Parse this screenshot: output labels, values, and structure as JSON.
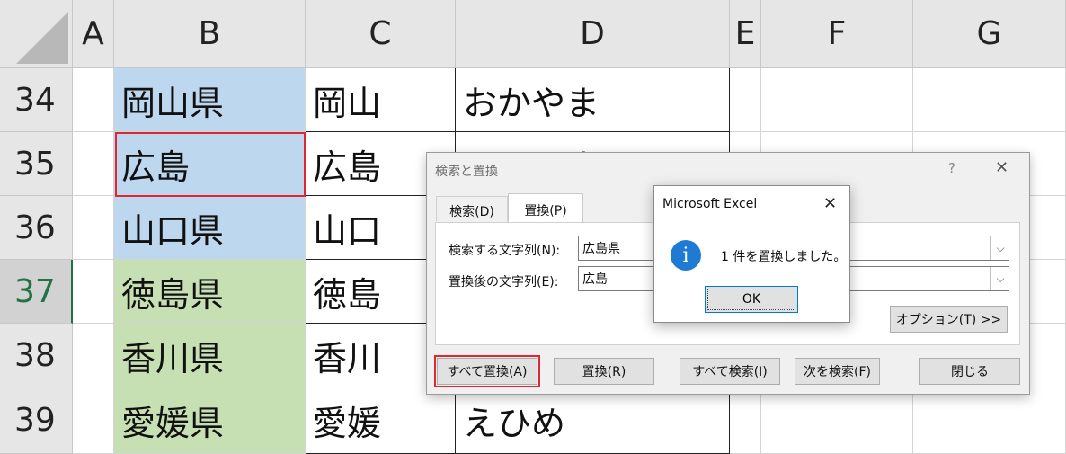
{
  "columns": [
    "A",
    "B",
    "C",
    "D",
    "E",
    "F",
    "G"
  ],
  "rows": [
    {
      "num": "34",
      "b": "岡山県",
      "c": "岡山",
      "d": "おかやま",
      "color": "blue"
    },
    {
      "num": "35",
      "b": "広島",
      "c": "広島",
      "d": "ひろしま",
      "color": "blue"
    },
    {
      "num": "36",
      "b": "山口県",
      "c": "山口",
      "d": "",
      "color": "blue"
    },
    {
      "num": "37",
      "b": "徳島県",
      "c": "徳島",
      "d": "",
      "color": "green"
    },
    {
      "num": "38",
      "b": "香川県",
      "c": "香川",
      "d": "",
      "color": "green"
    },
    {
      "num": "39",
      "b": "愛媛県",
      "c": "愛媛",
      "d": "えひめ",
      "color": "green"
    }
  ],
  "find_replace": {
    "title": "検索と置換",
    "help": "?",
    "close": "✕",
    "tabs": {
      "find": "検索(D)",
      "replace": "置換(P)"
    },
    "find_label": "検索する文字列(N):",
    "find_value": "広島県",
    "replace_label": "置換後の文字列(E):",
    "replace_value": "広島",
    "options_button": "オプション(T) >>",
    "buttons": {
      "replace_all": "すべて置換(A)",
      "replace": "置換(R)",
      "find_all": "すべて検索(I)",
      "find_next": "次を検索(F)",
      "close": "閉じる"
    }
  },
  "message_box": {
    "title": "Microsoft Excel",
    "close": "✕",
    "icon_glyph": "i",
    "text": "1 件を置換しました。",
    "ok": "OK"
  },
  "colors": {
    "blue": "#bdd7ee",
    "green": "#c6e0b4",
    "highlight": "#e0262f",
    "excel_green": "#217346"
  }
}
